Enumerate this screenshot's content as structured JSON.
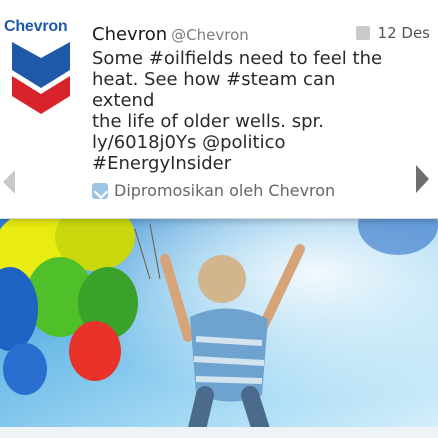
{
  "brand": {
    "logo_text": "Chevron",
    "colors": {
      "blue": "#1f5aa8",
      "red": "#d8232a"
    }
  },
  "tweet": {
    "display_name": "Chevron",
    "handle": "@Chevron",
    "timestamp": "12 Des",
    "text": "Some #oilfields need to feel the\nheat. See how #steam can extend\nthe life of older wells. spr.\nly/6018j0Ys @politico\n#EnergyInsider",
    "promoted_label": "Dipromosikan oleh Chevron"
  },
  "icons": {
    "prev": "chevron-left-icon",
    "next": "chevron-right-icon",
    "promoted": "promoted-icon",
    "timestamp": "photo-icon"
  },
  "hero": {
    "description_colors": {
      "sky": "#8fd0f0",
      "balloon_yellow": "#e8ec10",
      "balloon_green": "#4fbf2a",
      "balloon_blue": "#1e63c4",
      "balloon_red": "#e8322a"
    }
  }
}
